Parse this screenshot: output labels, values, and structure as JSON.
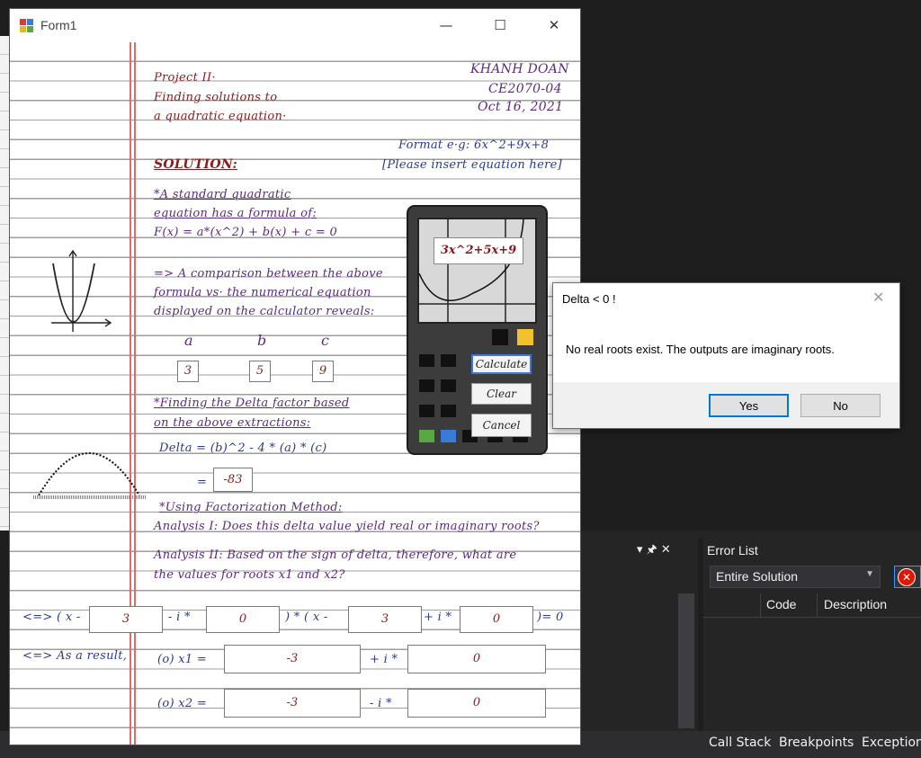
{
  "form": {
    "title": "Form1",
    "minimize": "—",
    "maximize": "☐",
    "close": "✕"
  },
  "header": {
    "project_line1": "Project II·",
    "project_line2": "Finding solutions to",
    "project_line3": "a quadratic equation·",
    "author": "KHANH DOAN",
    "course": "CE2070-04",
    "date": "Oct 16, 2021",
    "format_hint": "Format e·g: 6x^2+9x+8",
    "insert_hint": "[Please insert equation here]"
  },
  "solution": {
    "heading": "SOLUTION:",
    "std_line1": "*A standard quadratic",
    "std_line2": "equation has a formula of:",
    "formula": "F(x) = a*(x^2) + b(x) + c = 0",
    "cmp_line1": "=> A comparison between the above",
    "cmp_line2": "formula vs· the numerical equation",
    "cmp_line3": "displayed on the calculator reveals:"
  },
  "coefficients": {
    "a_label": "a",
    "b_label": "b",
    "c_label": "c",
    "a_value": "3",
    "b_value": "5",
    "c_value": "9"
  },
  "delta": {
    "line1": "*Finding the Delta factor based",
    "line2": "on the above extractions:",
    "formula": "Delta = (b)^2 - 4 * (a) * (c)",
    "equals": "=",
    "value": "-83"
  },
  "factorization": {
    "heading": "*Using Factorization Method:",
    "analysis1": "Analysis I: Does this delta value yield real or imaginary roots?",
    "analysis2_line1": "Analysis II: Based on the sign of delta, therefore, what are",
    "analysis2_line2": "the values for roots x1 and x2?",
    "eq_prefix": "<=> ( x -",
    "eq_minus_i": "- i *",
    "eq_mid": ") * ( x -",
    "eq_plus_i": "+ i *",
    "eq_end": ")= 0",
    "f1": "3",
    "f2": "0",
    "f3": "3",
    "f4": "0"
  },
  "result": {
    "label": "<=> As a result,",
    "x1_label": "(o) x1 =",
    "x2_label": "(o) x2 =",
    "plus_i": "+ i *",
    "minus_i": "- i *",
    "x1_real": "-3",
    "x1_imag": "0",
    "x2_real": "-3",
    "x2_imag": "0"
  },
  "calculator": {
    "equation": "3x^2+5x+9",
    "calculate": "Calculate",
    "clear": "Clear",
    "cancel": "Cancel"
  },
  "dialog": {
    "title": "Delta < 0 !",
    "close": "✕",
    "message": "No real roots exist. The outputs are imaginary roots.",
    "yes": "Yes",
    "no": "No"
  },
  "vs": {
    "panel_pin": "▾ 🖈 ✕",
    "error_list_title": "Error List",
    "scope": "Entire Solution",
    "col_code": "Code",
    "col_description": "Description",
    "tab_call_stack": "Call Stack",
    "tab_breakpoints": "Breakpoints",
    "tab_exception": "Exception"
  },
  "colors": {
    "margin_red": "#e46a6a",
    "ink_red": "#8b1a1a",
    "ink_purple": "#5a2a80",
    "ink_blue": "#2a3a8c",
    "vs_dark": "#1e1e1e",
    "accent_blue": "#3399ff"
  }
}
